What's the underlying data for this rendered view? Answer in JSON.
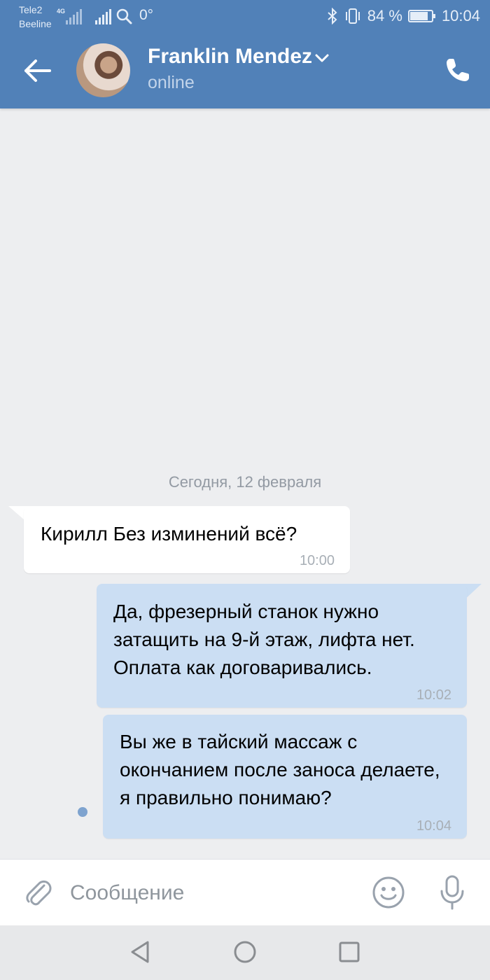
{
  "status_bar": {
    "carrier_1": "Tele2",
    "carrier_2": "Beeline",
    "network": "4G",
    "temperature": "0°",
    "battery": "84 %",
    "battery_level": 0.84,
    "time": "10:04"
  },
  "header": {
    "contact_name": "Franklin Mendez",
    "contact_status": "online"
  },
  "chat": {
    "date_separator": "Сегодня, 12 февраля",
    "messages": [
      {
        "direction": "incoming",
        "text": "Кирилл  Без изминений всё?",
        "time": "10:00"
      },
      {
        "direction": "outgoing",
        "text": "Да, фрезерный станок нужно затащить на 9-й этаж, лифта нет. Оплата как договаривались.",
        "time": "10:02"
      },
      {
        "direction": "outgoing",
        "text": "Вы же в тайский массаж с окончанием после заноса делаете, я правильно понимаю?",
        "time": "10:04",
        "unread": true
      }
    ]
  },
  "composer": {
    "placeholder": "Сообщение"
  },
  "icons": {
    "back": "arrow-left-icon",
    "call": "phone-icon",
    "attach": "paperclip-icon",
    "emoji": "smiley-icon",
    "mic": "microphone-icon",
    "nav_back": "triangle-back-icon",
    "nav_home": "circle-home-icon",
    "nav_recents": "square-recents-icon"
  },
  "colors": {
    "header_blue": "#5181b8",
    "outgoing_bubble": "#cbdef3",
    "incoming_bubble": "#ffffff",
    "chat_background": "#edeef0"
  }
}
